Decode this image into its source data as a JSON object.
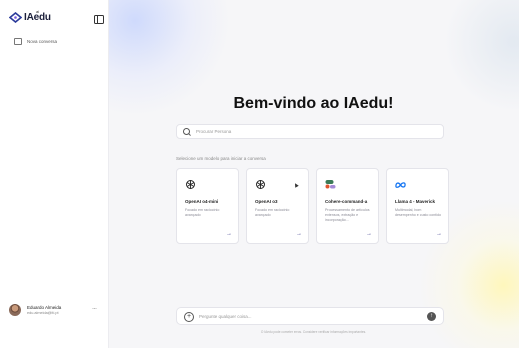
{
  "brand": {
    "logo_text": "IAedu",
    "logo_sup": "ai"
  },
  "sidebar": {
    "new_chat_label": "Nova conversa"
  },
  "user": {
    "name": "Eduardo Almeida",
    "email": "edu.almeida@iti.pt",
    "more": "···"
  },
  "main": {
    "title": "Bem-vindo ao IAedu!",
    "search_placeholder": "Procurar Persona",
    "section_label": "Selecione um modelo para iniciar a conversa",
    "models": [
      {
        "name": "OpenAI o4-mini",
        "description": "Focado em raciocínio avançado",
        "icon": "openai-icon"
      },
      {
        "name": "OpenAI o3",
        "description": "Focado em raciocínio avançado",
        "icon": "openai-icon"
      },
      {
        "name": "Cohere-command-a",
        "description": "Processamento de artículos extensos, extração e incorporação...",
        "icon": "cohere-icon"
      },
      {
        "name": "Llama 4 - Maverick",
        "description": "Multimodal, bom desempenho e custo contido",
        "icon": "meta-icon"
      }
    ],
    "arrow": "→"
  },
  "prompt": {
    "placeholder": "Pergunte qualquer coisa...",
    "plus": "+",
    "send": "↑",
    "disclaimer": "O IAedu pode cometer erros. Considere verificar informações importantes."
  },
  "colors": {
    "accent": "#3a3a8a",
    "cohere_red": "#e0552e",
    "cohere_green": "#3b7a57",
    "meta_blue": "#1877f2"
  }
}
